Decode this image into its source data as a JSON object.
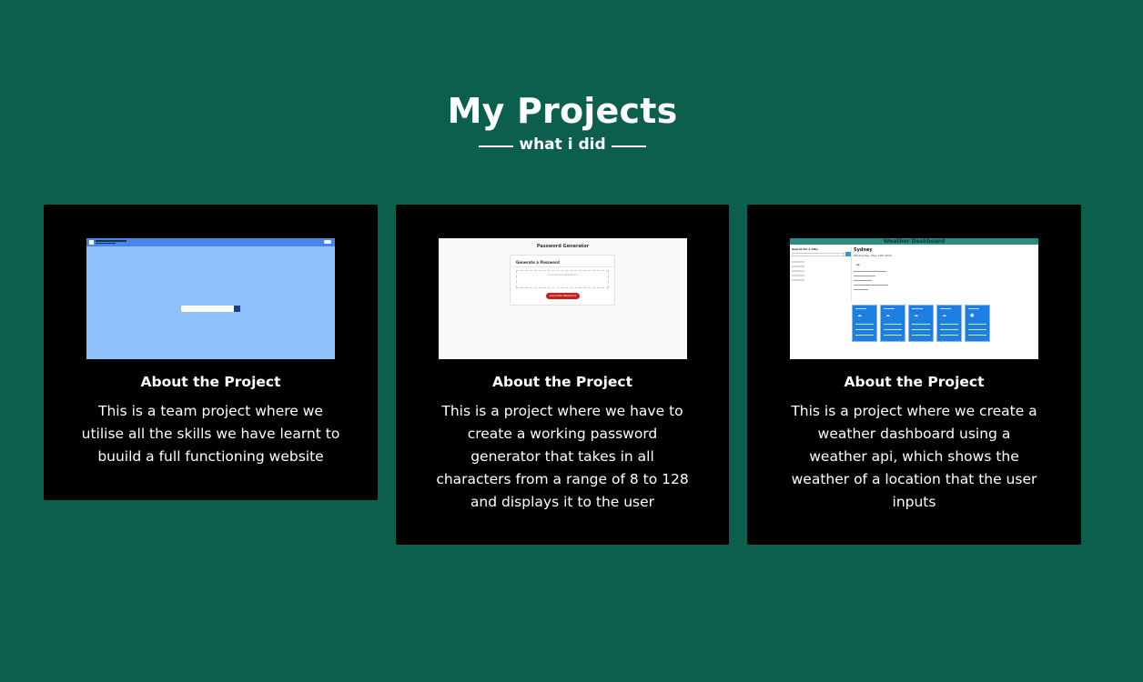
{
  "section": {
    "title": "My Projects",
    "subtitle": "what i did"
  },
  "projects": [
    {
      "heading": "About the Project",
      "description": "This is a team project where we utilise all the skills we have learnt to buuild a full functioning website"
    },
    {
      "heading": "About the Project",
      "description": "This is a project where we have to create a working password generator that takes in all characters from a range of 8 to 128 and displays it to the user",
      "thumbnail": {
        "title": "Password Generator",
        "panel_title": "Generate a Password",
        "placeholder": "Your Secure Password",
        "button": "Generate Password"
      }
    },
    {
      "heading": "About the Project",
      "description": "This is a project where we create a weather dashboard using a weather api, which shows the weather of a location that the user inputs",
      "thumbnail": {
        "header": "Weather Dashboard",
        "search_title": "Search for a City:",
        "city": "Sydney",
        "date": "Wednesday, May 11th 2022"
      }
    }
  ],
  "colors": {
    "background": "#0c5e4d",
    "card": "#000000",
    "text": "#ffffff"
  }
}
